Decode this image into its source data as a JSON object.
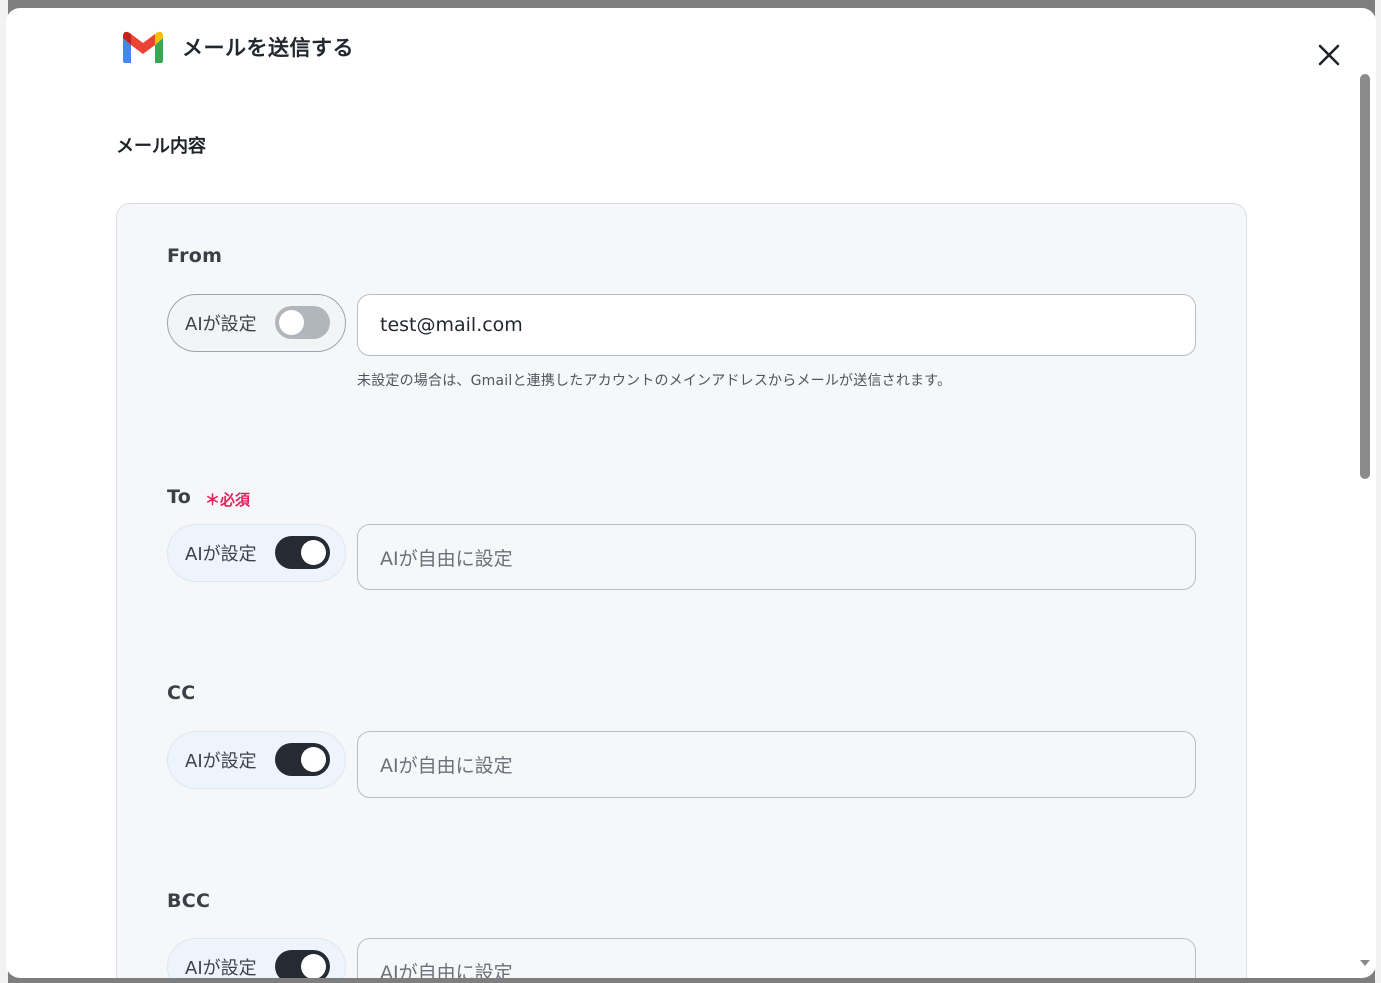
{
  "modal": {
    "title": "メールを送信する",
    "section_title": "メール内容"
  },
  "fields": [
    {
      "label": "From",
      "required": false,
      "ai_label": "AIが設定",
      "ai_enabled": false,
      "value": "test@mail.com",
      "placeholder": "",
      "help": "未設定の場合は、Gmailと連携したアカウントのメインアドレスからメールが送信されます。"
    },
    {
      "label": "To",
      "required": true,
      "required_label": "＊必須",
      "ai_label": "AIが設定",
      "ai_enabled": true,
      "value": "",
      "placeholder": "AIが自由に設定"
    },
    {
      "label": "CC",
      "required": false,
      "ai_label": "AIが設定",
      "ai_enabled": true,
      "value": "",
      "placeholder": "AIが自由に設定"
    },
    {
      "label": "BCC",
      "required": false,
      "ai_label": "AIが設定",
      "ai_enabled": true,
      "value": "",
      "placeholder": "AIが自由に設定"
    }
  ],
  "colors": {
    "required": "#e0245e",
    "toggle_on": "#252a33",
    "toggle_off": "#b1b6bd"
  },
  "icons": {
    "logo": "gmail-icon",
    "close": "close-icon"
  }
}
